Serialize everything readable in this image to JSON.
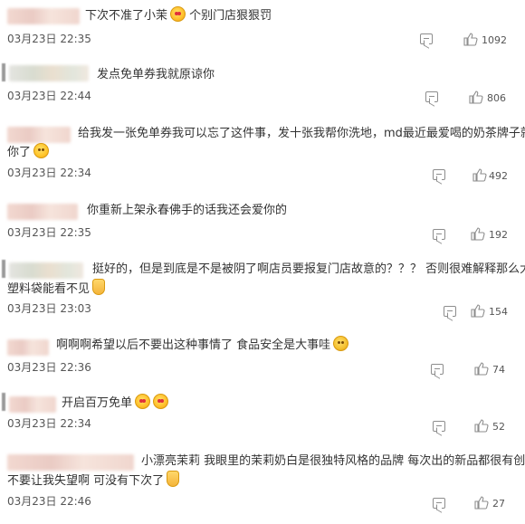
{
  "comments": [
    {
      "text": "下次不准了小茉",
      "text_after": "个别门店狠狠罚",
      "emoji_name": "heart-eyes-emoji",
      "date": "03月23日 22:35",
      "likes": "1092"
    },
    {
      "text": "发点免单券我就原谅你",
      "date": "03月23日 22:44",
      "likes": "806"
    },
    {
      "text": "给我发一张免单券我可以忘了这件事，发十张我帮你洗地，md最近最爱喝的奶茶牌子就是",
      "text_line2": "你了",
      "emoji_name": "smile-emoji",
      "date": "03月23日 22:34",
      "likes": "492"
    },
    {
      "text": "你重新上架永春佛手的话我还会爱你的",
      "date": "03月23日 22:35",
      "likes": "192"
    },
    {
      "text": "挺好的，但是到底是不是被阴了啊店员要报复门店故意的？？？ 否则很难解释那么大个",
      "text_line2": "塑料袋能看不见",
      "emoji_name": "crying-emoji",
      "date": "03月23日 23:03",
      "likes": "154"
    },
    {
      "text": "啊啊啊希望以后不要出这种事情了 食品安全是大事哇",
      "emoji_name": "shocked-emoji",
      "date": "03月23日 22:36",
      "likes": "74"
    },
    {
      "text": "开启百万免单",
      "emoji_name": "kiss-emoji",
      "date": "03月23日 22:34",
      "likes": "52"
    },
    {
      "text": "小漂亮茉莉 我眼里的茉莉奶白是很独特风格的品牌 每次出的新品都很有创意",
      "text_line2": "不要让我失望啊 可没有下次了",
      "emoji_name": "victory-hand-emoji",
      "date": "03月23日 22:46",
      "likes": "27"
    }
  ]
}
